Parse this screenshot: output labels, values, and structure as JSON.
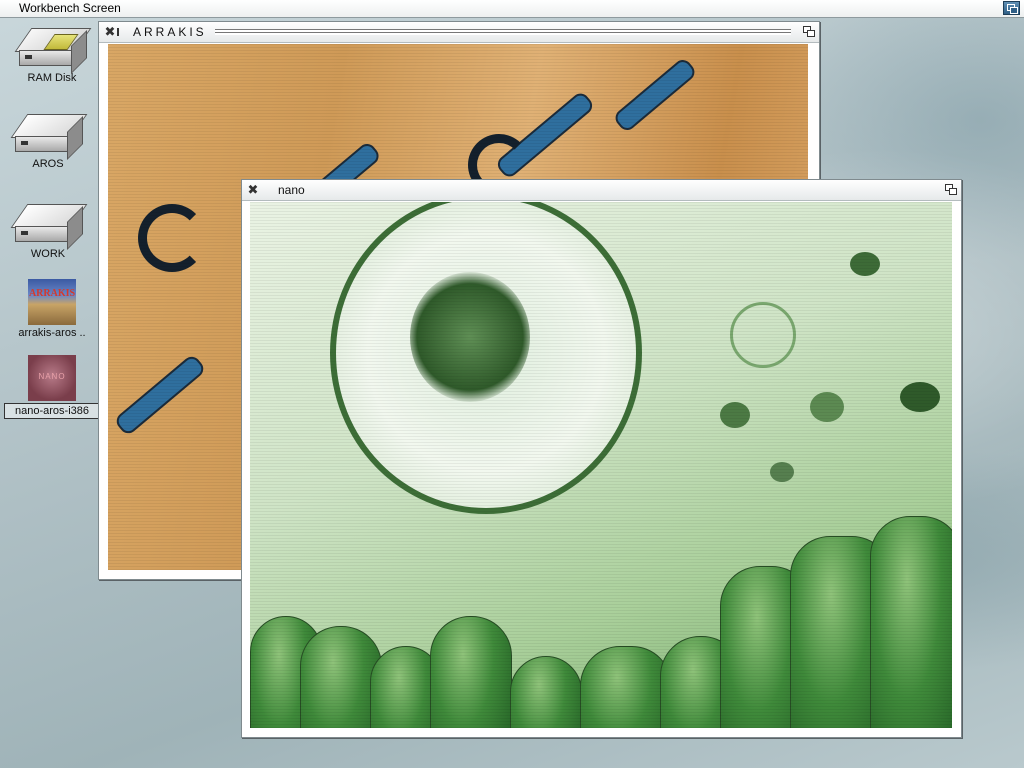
{
  "screen": {
    "title": "Workbench Screen"
  },
  "desktop_icons": [
    {
      "label": "RAM Disk",
      "kind": "ram-disk-icon"
    },
    {
      "label": "AROS",
      "kind": "hard-drive-icon"
    },
    {
      "label": "WORK",
      "kind": "hard-drive-icon"
    },
    {
      "label": "arrakis-aros ..",
      "kind": "image-thumbnail-icon",
      "thumb_text": "ARRAKIS"
    },
    {
      "label": "nano-aros-i386",
      "kind": "image-thumbnail-icon",
      "thumb_text": "NANO",
      "selected": true
    }
  ],
  "windows": {
    "arrakis": {
      "title": "ARRAKIS"
    },
    "nano": {
      "title": "nano"
    }
  },
  "colors": {
    "accent": "#2f5f86",
    "arrakis_sand": "#d9a765",
    "nano_green": "#3f8a3a"
  }
}
